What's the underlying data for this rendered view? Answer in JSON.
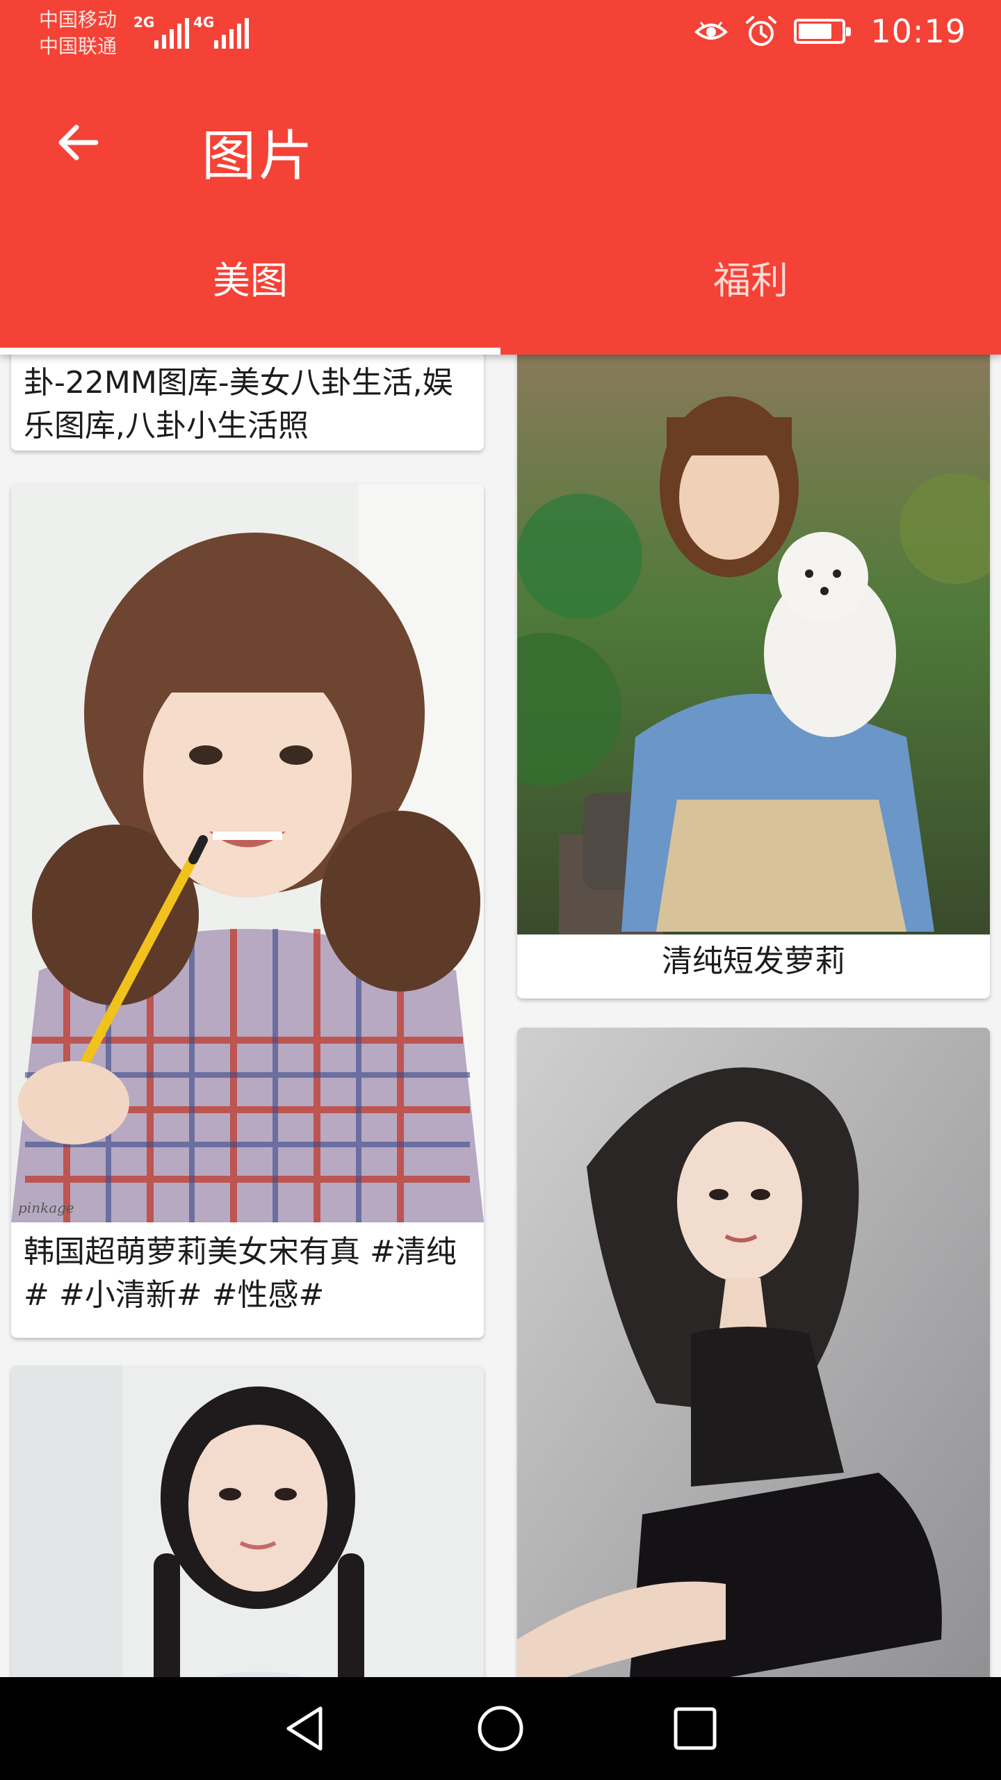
{
  "status": {
    "carrier_1": "中国移动",
    "carrier_2": "中国联通",
    "net_1": "2G",
    "net_2": "4G",
    "time": "10:19",
    "battery_level_percent": 80
  },
  "toolbar": {
    "title": "图片",
    "back_icon": "arrow-left-icon"
  },
  "tabs": [
    {
      "label": "美图",
      "selected": true
    },
    {
      "label": "福利",
      "selected": false
    }
  ],
  "cards": [
    {
      "caption": "卦-22MM图库-美女八卦生活,娱乐图库,八卦小生活照"
    },
    {
      "caption": "清纯短发萝莉"
    },
    {
      "caption": "韩国超萌萝莉美女宋有真 #清纯# #小清新# #性感#"
    },
    {
      "caption": ""
    },
    {
      "caption": ""
    }
  ],
  "watermark": "pinkage",
  "navbar": {
    "back": "triangle-back-icon",
    "home": "circle-home-icon",
    "recents": "square-recents-icon"
  },
  "colors": {
    "primary": "#f44236",
    "tab_inactive": "#ffd9d5",
    "navbar": "#000000"
  }
}
